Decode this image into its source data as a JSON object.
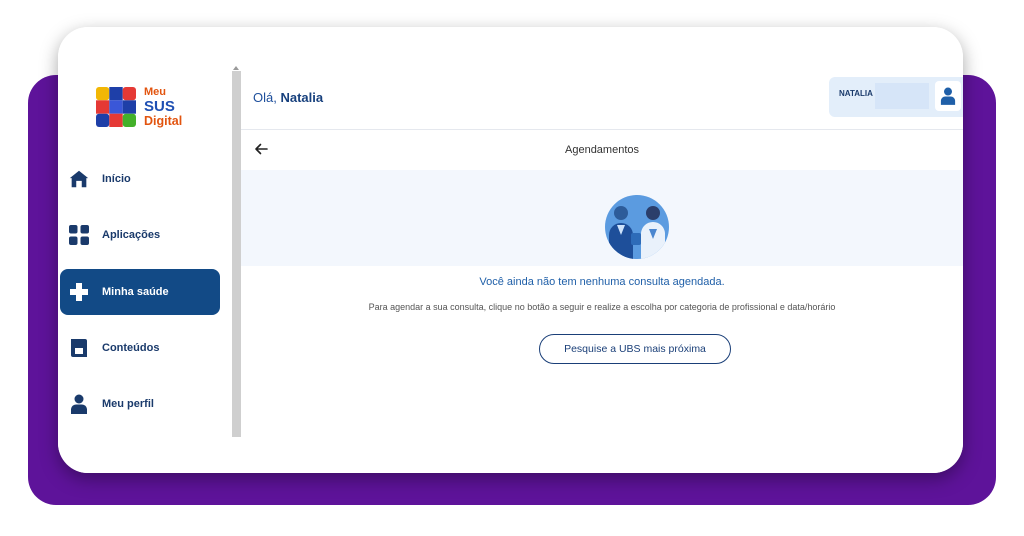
{
  "app": {
    "logo": {
      "line1": "Meu",
      "line2": "SUS",
      "line3": "Digital"
    }
  },
  "sidebar": {
    "items": [
      {
        "label": "Início",
        "icon": "home-icon",
        "active": false
      },
      {
        "label": "Aplicações",
        "icon": "apps-grid-icon",
        "active": false
      },
      {
        "label": "Minha saúde",
        "icon": "health-cross-icon",
        "active": true
      },
      {
        "label": "Conteúdos",
        "icon": "book-icon",
        "active": false
      },
      {
        "label": "Meu perfil",
        "icon": "person-icon",
        "active": false
      }
    ]
  },
  "header": {
    "greeting_prefix": "Olá,",
    "user_name": "Natalia",
    "user_badge_name": "NATALIA"
  },
  "page": {
    "title": "Agendamentos",
    "empty_message": "Você ainda não tem nenhuma consulta agendada.",
    "hint": "Para agendar a sua consulta, clique no botão a seguir e realize a escolha por categoria de profissional e data/horário",
    "cta_label": "Pesquise a UBS mais próxima"
  },
  "colors": {
    "purple_bg": "#5e139a",
    "active_nav": "#124a86",
    "primary_text": "#1a3a6b",
    "link_blue": "#1f5fa8"
  }
}
